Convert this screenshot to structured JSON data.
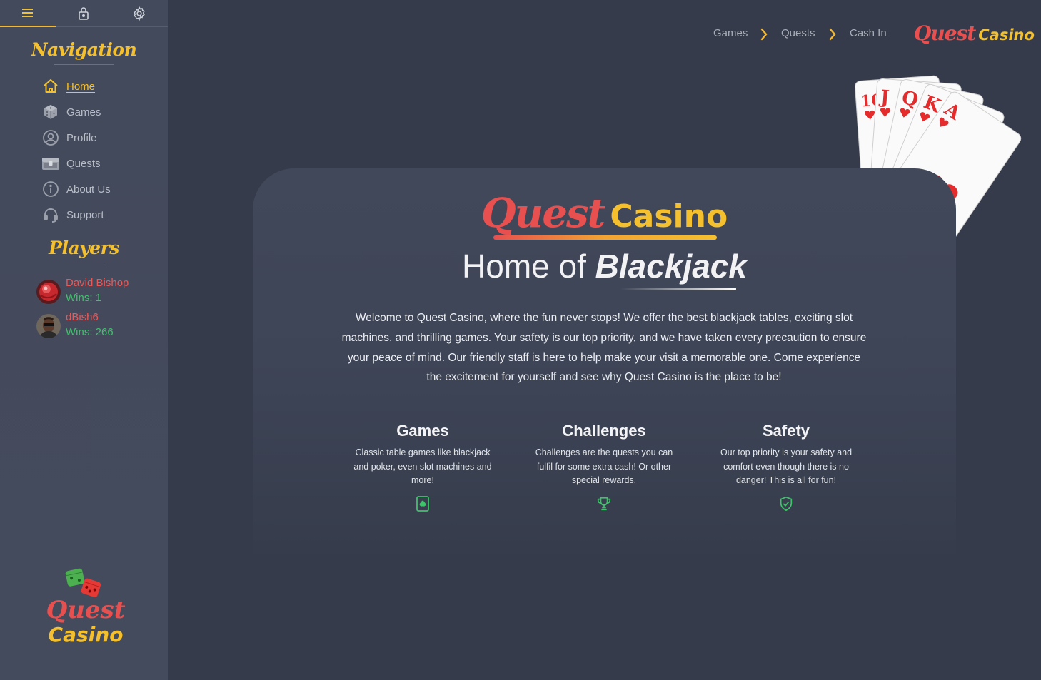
{
  "sidebar": {
    "topbar": [
      {
        "icon": "menu-icon"
      },
      {
        "icon": "lock-icon"
      },
      {
        "icon": "gear-icon"
      }
    ],
    "navigation_heading": "Navigation",
    "nav_items": [
      {
        "label": "Home",
        "icon": "home-icon",
        "active": true
      },
      {
        "label": "Games",
        "icon": "dice-icon",
        "active": false
      },
      {
        "label": "Profile",
        "icon": "user-circle-icon",
        "active": false
      },
      {
        "label": "Quests",
        "icon": "treasure-chest-icon",
        "active": false
      },
      {
        "label": "About Us",
        "icon": "info-icon",
        "active": false
      },
      {
        "label": "Support",
        "icon": "headset-icon",
        "active": false
      }
    ],
    "players_heading": "Players",
    "players": [
      {
        "name": "David Bishop",
        "wins": "Wins: 1"
      },
      {
        "name": "dBish6",
        "wins": "Wins: 266"
      }
    ],
    "logo": {
      "quest": "Quest",
      "casino": "Casino"
    }
  },
  "header": {
    "breadcrumbs": [
      "Games",
      "Quests",
      "Cash In"
    ],
    "brand": {
      "quest": "Quest",
      "casino": "Casino"
    }
  },
  "hero": {
    "title_quest": "Quest",
    "title_casino": "Casino",
    "subtitle_prefix": "Home of",
    "subtitle_emphasis": "Blackjack",
    "welcome": "Welcome to Quest Casino, where the fun never stops! We offer the best blackjack tables, exciting slot machines, and thrilling games. Your safety is our top priority, and we have taken every precaution to ensure your peace of mind. Our friendly staff is here to help make your visit a memorable one. Come experience the excitement for yourself and see why Quest Casino is the place to be!"
  },
  "features": [
    {
      "title": "Games",
      "desc": "Classic table games like blackjack and poker, even slot machines and more!",
      "icon": "spade-card-icon"
    },
    {
      "title": "Challenges",
      "desc": "Challenges are the quests you can fulfil for some extra cash! Or other special rewards.",
      "icon": "trophy-icon"
    },
    {
      "title": "Safety",
      "desc": "Our top priority is your safety and comfort even though there is no danger! This is all for fun!",
      "icon": "shield-check-icon"
    }
  ],
  "decoration": {
    "cards": [
      "10",
      "J",
      "Q",
      "K",
      "A"
    ]
  },
  "colors": {
    "accent_yellow": "#f5c02e",
    "accent_red": "#e85050",
    "accent_green": "#3fc26a",
    "background": "#353b4a",
    "sidebar": "#434a5c"
  }
}
